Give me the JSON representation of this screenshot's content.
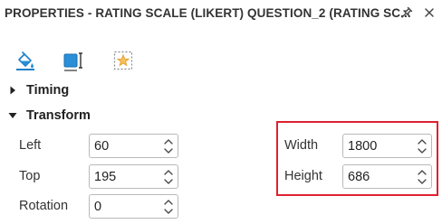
{
  "title": "PROPERTIES - RATING SCALE (LIKERT) QUESTION_2 (RATING SC...",
  "toolbar": {
    "tabs": [
      {
        "icon": "paint-bucket-icon"
      },
      {
        "icon": "transform-size-icon",
        "selected": true
      },
      {
        "icon": "star-effect-icon"
      }
    ]
  },
  "sections": {
    "timing": {
      "label": "Timing",
      "expanded": false
    },
    "transform": {
      "label": "Transform",
      "expanded": true
    }
  },
  "transform": {
    "left": {
      "label": "Left",
      "value": "60"
    },
    "top": {
      "label": "Top",
      "value": "195"
    },
    "rotation": {
      "label": "Rotation",
      "value": "0"
    },
    "width": {
      "label": "Width",
      "value": "1800"
    },
    "height": {
      "label": "Height",
      "value": "686"
    }
  },
  "colors": {
    "accent_blue": "#2a8fd6",
    "highlight_red": "#e02030",
    "star_orange": "#e8a23a"
  }
}
